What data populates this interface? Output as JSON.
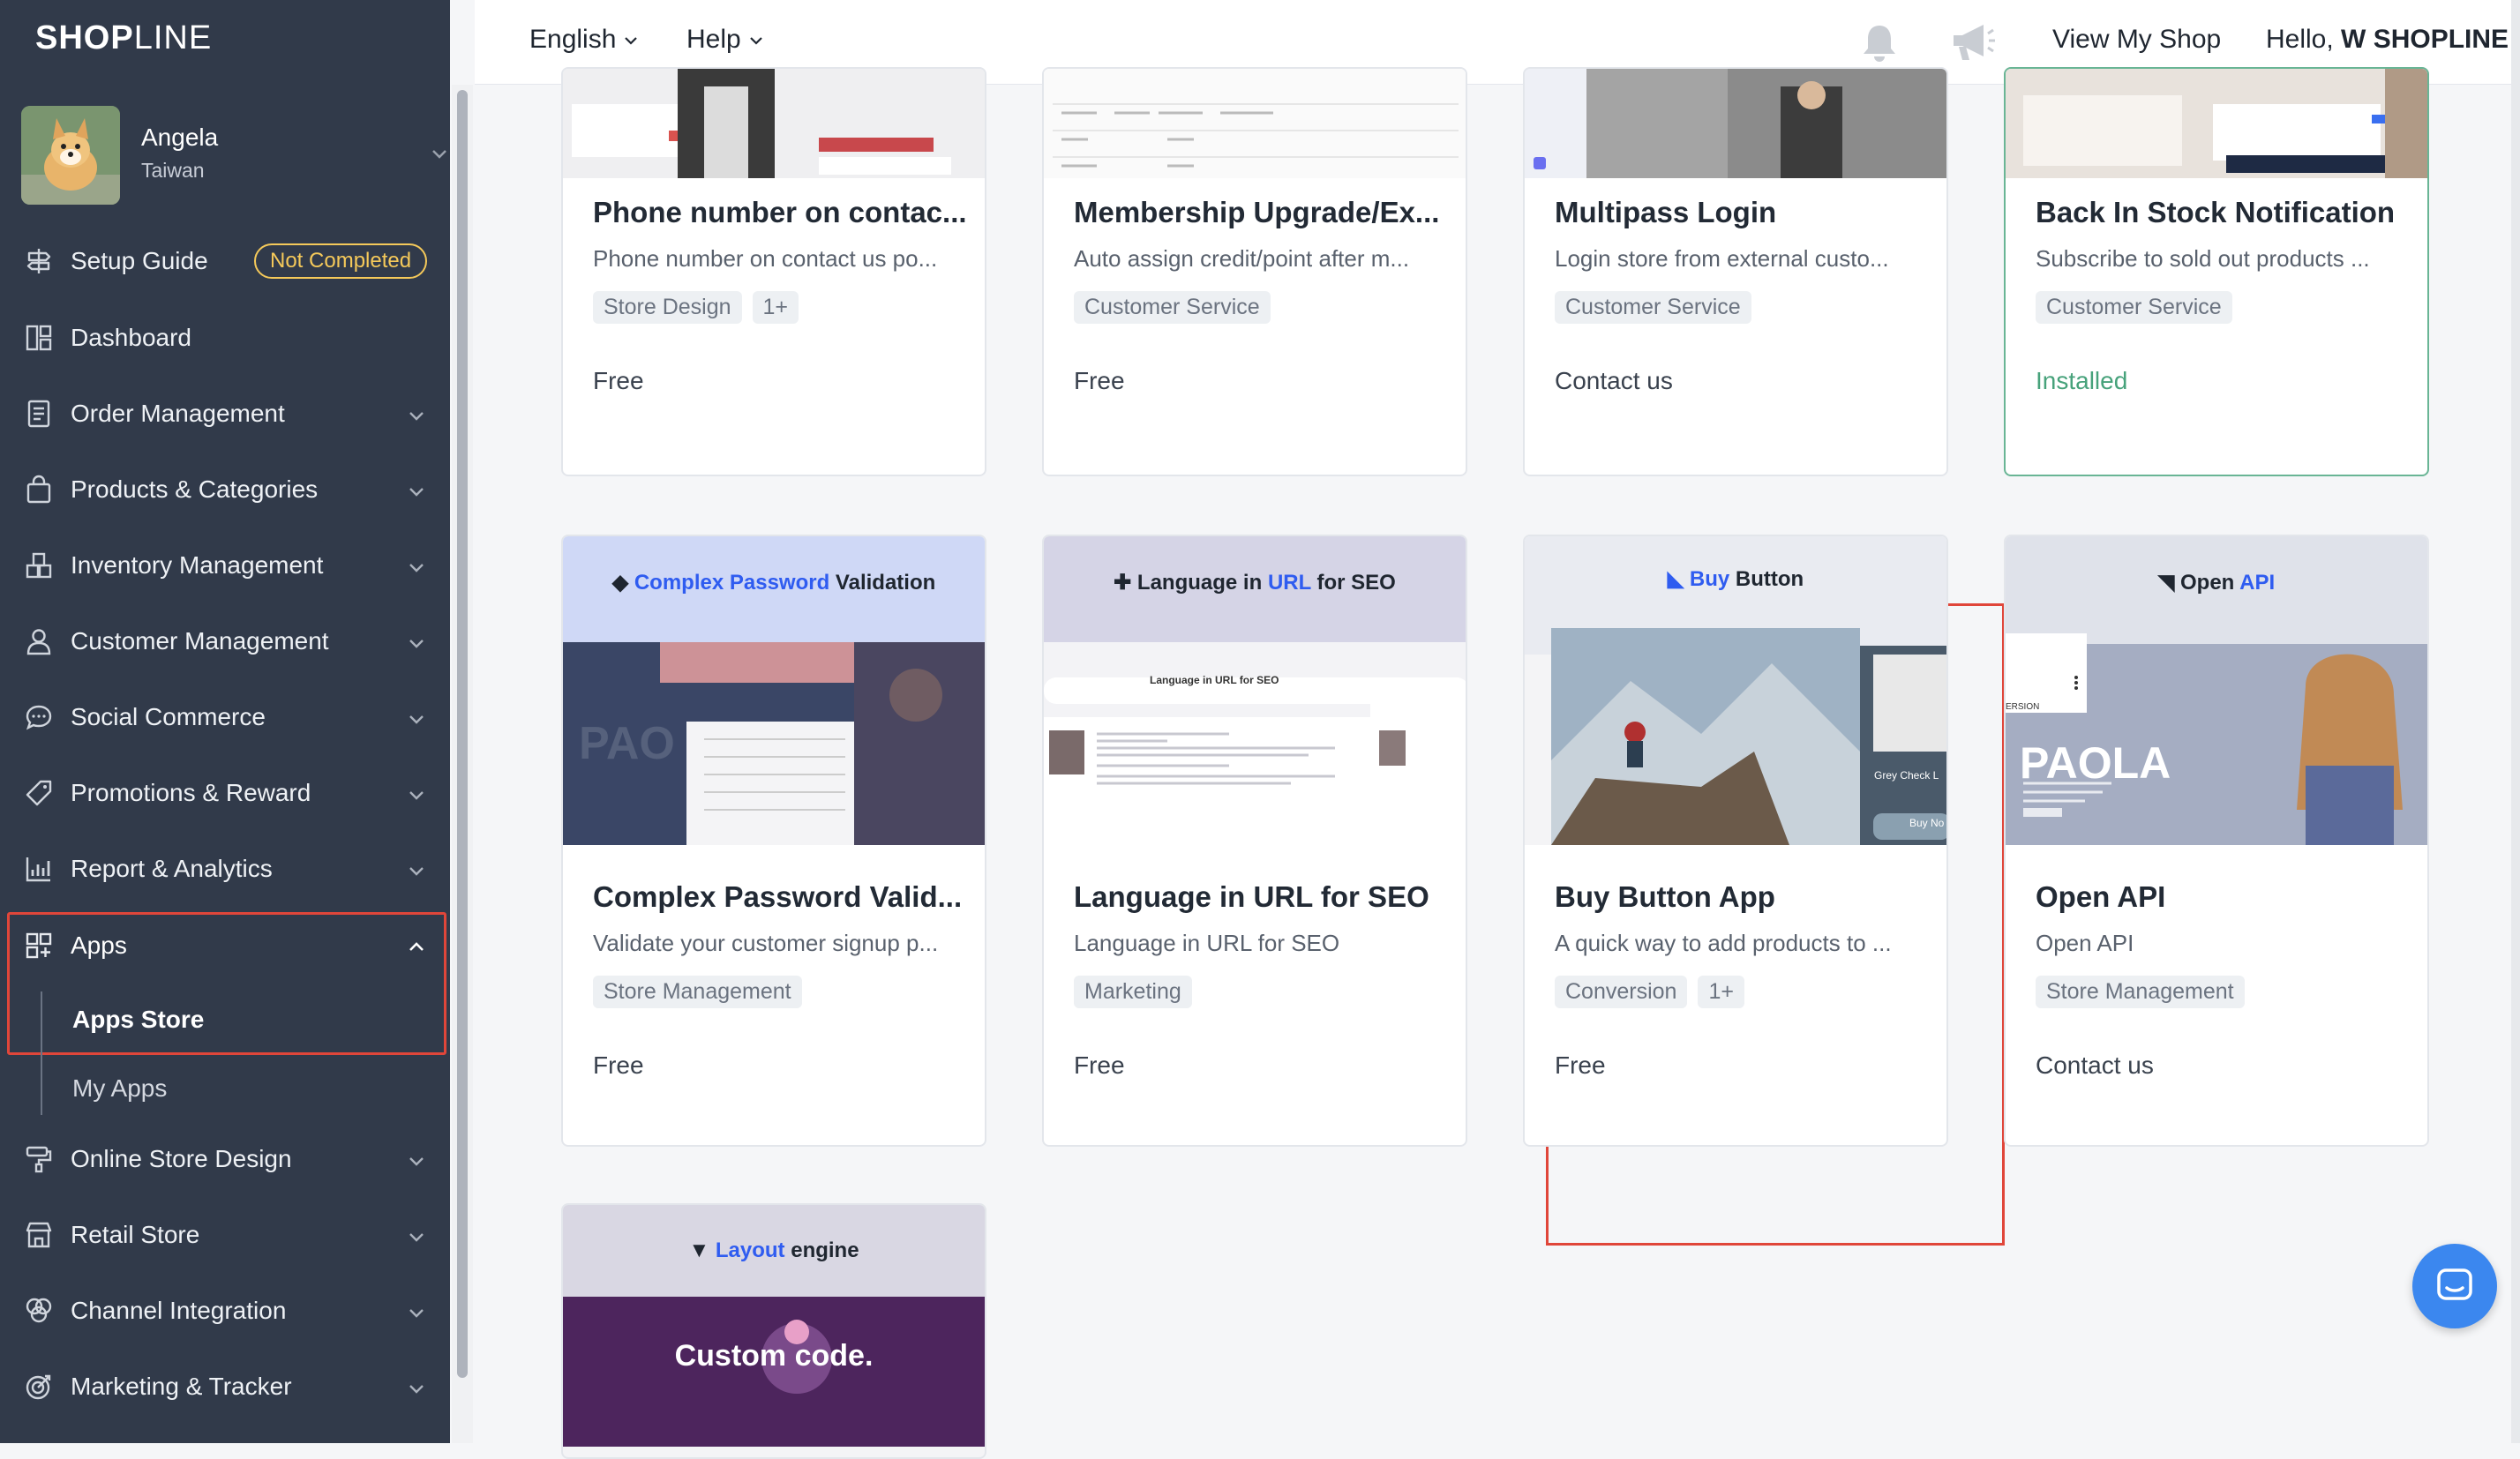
{
  "brand": {
    "logo_main": "SHOP",
    "logo_lite": "LINE"
  },
  "user": {
    "name": "Angela",
    "region": "Taiwan"
  },
  "sidebar": {
    "setup_guide": "Setup Guide",
    "setup_badge": "Not Completed",
    "items": [
      {
        "label": "Dashboard",
        "icon": "dashboard-icon"
      },
      {
        "label": "Order Management",
        "icon": "order-icon"
      },
      {
        "label": "Products & Categories",
        "icon": "bag-icon"
      },
      {
        "label": "Inventory Management",
        "icon": "inventory-icon"
      },
      {
        "label": "Customer Management",
        "icon": "person-icon"
      },
      {
        "label": "Social Commerce",
        "icon": "chat-icon"
      },
      {
        "label": "Promotions & Reward",
        "icon": "tag-icon"
      },
      {
        "label": "Report & Analytics",
        "icon": "chart-icon"
      },
      {
        "label": "Apps",
        "icon": "apps-icon"
      },
      {
        "label": "Online Store Design",
        "icon": "paint-icon"
      },
      {
        "label": "Retail Store",
        "icon": "store-icon"
      },
      {
        "label": "Channel Integration",
        "icon": "channel-icon"
      },
      {
        "label": "Marketing & Tracker",
        "icon": "target-icon"
      }
    ],
    "apps_sub": [
      "Apps Store",
      "My Apps"
    ]
  },
  "topbar": {
    "language": "English",
    "help": "Help",
    "view_shop": "View My Shop",
    "greeting": "Hello,",
    "shop_name": "W SHOPLINE"
  },
  "apps": [
    {
      "title": "Phone number on contac...",
      "desc": "Phone number on contact us po...",
      "tags": [
        "Store Design",
        "1+"
      ],
      "price": "Free"
    },
    {
      "title": "Membership Upgrade/Ex...",
      "desc": "Auto assign credit/point after m...",
      "tags": [
        "Customer Service"
      ],
      "price": "Free"
    },
    {
      "title": "Multipass Login",
      "desc": "Login store from external custo...",
      "tags": [
        "Customer Service"
      ],
      "price": "Contact us"
    },
    {
      "title": "Back In Stock Notification",
      "desc": "Subscribe to sold out products ...",
      "tags": [
        "Customer Service"
      ],
      "price": "Installed"
    },
    {
      "title": "Complex Password Valid...",
      "desc": "Validate your customer signup p...",
      "tags": [
        "Store Management"
      ],
      "price": "Free",
      "banner": {
        "pre": "Complex Password",
        "post": " Validation"
      }
    },
    {
      "title": "Language in URL for SEO",
      "desc": "Language in URL for SEO",
      "tags": [
        "Marketing"
      ],
      "price": "Free",
      "banner": {
        "a": "Language in ",
        "b": "URL",
        "c": " for SEO",
        "mini": "Language in URL for SEO"
      }
    },
    {
      "title": "Buy Button App",
      "desc": "A quick way to add products to ...",
      "tags": [
        "Conversion",
        "1+"
      ],
      "price": "Free",
      "banner": {
        "a": "Buy",
        "b": " Button",
        "grey": "Grey Check L",
        "buy": "Buy No"
      }
    },
    {
      "title": "Open API",
      "desc": "Open API",
      "tags": [
        "Store Management"
      ],
      "price": "Contact us",
      "banner": {
        "a": "Open ",
        "b": "API",
        "paola": "PAOLA",
        "ersion": "ERSION"
      }
    },
    {
      "banner": {
        "a": "Layout",
        "b": " engine",
        "big": "Custom code."
      }
    }
  ],
  "colors": {
    "sidebar": "#313a4a",
    "accent_red": "#e0463a",
    "badge": "#f5c95a",
    "installed": "#47a27b",
    "brand_blue": "#2f5cf0"
  }
}
